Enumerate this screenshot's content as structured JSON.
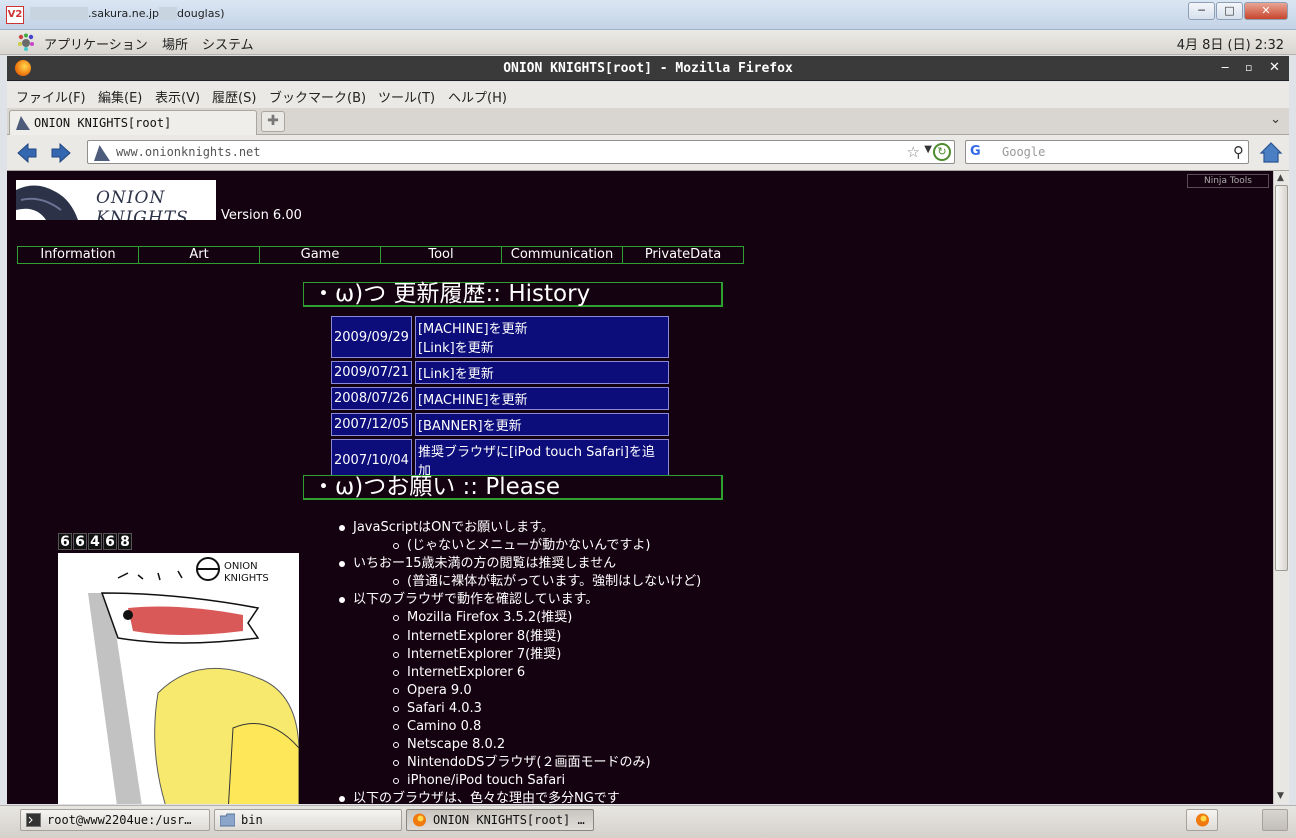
{
  "vnc": {
    "title_suffix": ".sakura.ne.jp",
    "title_user": "douglas)",
    "icon": "V2",
    "btn_min": "─",
    "btn_max": "□",
    "btn_close": "✕"
  },
  "gnome_panel": {
    "menus": [
      "アプリケーション",
      "場所",
      "システム"
    ],
    "clock": "4月 8日 (日)  2:32"
  },
  "firefox": {
    "window_title": "ONION KNIGHTS[root] - Mozilla Firefox",
    "controls": {
      "min": "‒",
      "max": "▫",
      "close": "✕"
    },
    "menubar": [
      "ファイル(F)",
      "編集(E)",
      "表示(V)",
      "履歴(S)",
      "ブックマーク(B)",
      "ツール(T)",
      "ヘルプ(H)"
    ],
    "tab_title": "ONION KNIGHTS[root]",
    "new_tab": "✚",
    "tab_list": "⌄",
    "url": "www.onionknights.net",
    "url_star": "☆",
    "url_dropdown": "▼",
    "reload": "↻",
    "search_engine": "G",
    "search_placeholder": "Google",
    "search_go": "⚲"
  },
  "page": {
    "logo_text": "ONION KNIGHTS",
    "version": "Version 6.00",
    "ninja_tools": "Ninja Tools",
    "nav": [
      "Information",
      "Art",
      "Game",
      "Tool",
      "Communication",
      "PrivateData"
    ],
    "history_heading": "・ω)つ 更新履歴:: History",
    "history": [
      {
        "date": "2009/09/29",
        "desc1": "[MACHINE]を更新",
        "desc2": "[Link]を更新"
      },
      {
        "date": "2009/07/21",
        "desc1": "[Link]を更新",
        "desc2": ""
      },
      {
        "date": "2008/07/26",
        "desc1": "[MACHINE]を更新",
        "desc2": ""
      },
      {
        "date": "2007/12/05",
        "desc1": "[BANNER]を更新",
        "desc2": ""
      },
      {
        "date": "2007/10/04",
        "desc1": "推奨ブラウザに[iPod touch Safari]を追加",
        "desc2": ""
      }
    ],
    "please_heading": "・ω)つお願い :: Please",
    "counter": [
      "6",
      "6",
      "4",
      "6",
      "8"
    ],
    "kite_logo_text": "ONION KNIGHTS",
    "please_items": [
      {
        "text": "JavaScriptはONでお願いします。",
        "sub": false
      },
      {
        "text": "(じゃないとメニューが動かないんですよ)",
        "sub": true
      },
      {
        "text": "いちおー15歳未満の方の閲覧は推奨しません",
        "sub": false
      },
      {
        "text": "(普通に裸体が転がっています。強制はしないけど)",
        "sub": true
      },
      {
        "text": "以下のブラウザで動作を確認しています。",
        "sub": false
      },
      {
        "text": "Mozilla Firefox 3.5.2(推奨)",
        "sub": true
      },
      {
        "text": "InternetExplorer 8(推奨)",
        "sub": true
      },
      {
        "text": "InternetExplorer 7(推奨)",
        "sub": true
      },
      {
        "text": "InternetExplorer 6",
        "sub": true
      },
      {
        "text": "Opera 9.0",
        "sub": true
      },
      {
        "text": "Safari 4.0.3",
        "sub": true
      },
      {
        "text": "Camino 0.8",
        "sub": true
      },
      {
        "text": "Netscape 8.0.2",
        "sub": true
      },
      {
        "text": "NintendoDSブラウザ(２画面モードのみ)",
        "sub": true
      },
      {
        "text": "iPhone/iPod touch Safari",
        "sub": true
      },
      {
        "text": "以下のブラウザは、色々な理由で多分NGです",
        "sub": false
      }
    ]
  },
  "taskbar": [
    {
      "label": "root@www2204ue:/usr…",
      "icon": "terminal-icon"
    },
    {
      "label": "bin",
      "icon": "folder-icon"
    },
    {
      "label": "ONION KNIGHTS[root] …",
      "icon": "firefox-icon"
    }
  ]
}
